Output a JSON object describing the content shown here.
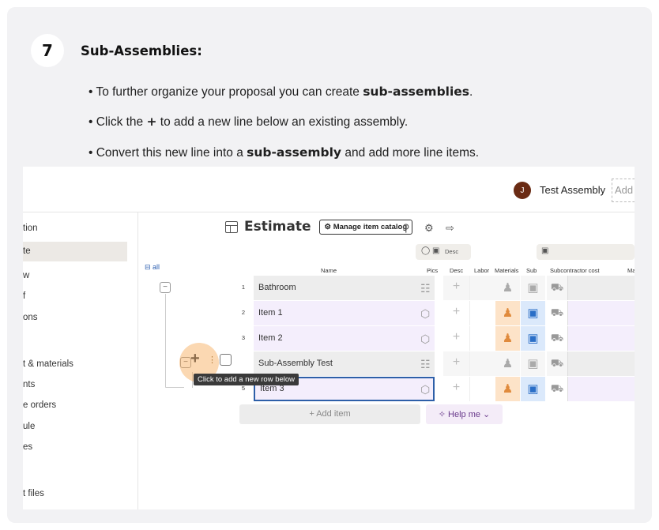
{
  "step": {
    "number": "7",
    "title": "Sub-Assemblies:",
    "bullets": [
      {
        "pre": "• To further organize your proposal you can create ",
        "bold": "sub-assemblies",
        "post": "."
      },
      {
        "pre": "• Click the ",
        "bold": "+",
        "post": " to add a new line below an existing assembly."
      },
      {
        "pre": "• Convert this new line into a ",
        "bold": "sub-assembly",
        "post": " and add more line items."
      }
    ]
  },
  "topbar": {
    "avatar_initial": "J",
    "project_name": "Test Assembly",
    "add_text": "Add"
  },
  "sidebar": {
    "items": [
      "tion",
      "te",
      "w",
      "f",
      "ons",
      "t & materials",
      "nts",
      "e orders",
      "ule",
      "es",
      "t files"
    ]
  },
  "toolbar": {
    "title": "Estimate",
    "catalog_button": "Manage item catalog"
  },
  "table": {
    "all_label": "all",
    "headers": {
      "name": "Name",
      "pics": "Pics",
      "desc": "Desc",
      "labor": "Labor",
      "materials": "Materials",
      "sub": "Sub",
      "subcontractor_cost": "Subcontractor cost",
      "more": "Ma"
    },
    "header_pill_desc": "Desc",
    "rows": [
      {
        "num": "1",
        "name": "Bathroom",
        "type": "assembly"
      },
      {
        "num": "2",
        "name": "Item 1",
        "type": "item"
      },
      {
        "num": "3",
        "name": "Item 2",
        "type": "item"
      },
      {
        "num": "",
        "name": "Sub-Assembly Test",
        "type": "assembly"
      },
      {
        "num": "5",
        "name": "Item 3",
        "type": "item-selected"
      }
    ],
    "tooltip": "Click to add a new row below",
    "add_item": "+ Add item",
    "help_me": "Help me"
  },
  "colors": {
    "assembly_row": "#ededed",
    "item_row": "#f4eefc",
    "labor_cell": "#fde3c8",
    "materials_cell": "#dbe9fb",
    "highlight": "#f6a855"
  }
}
